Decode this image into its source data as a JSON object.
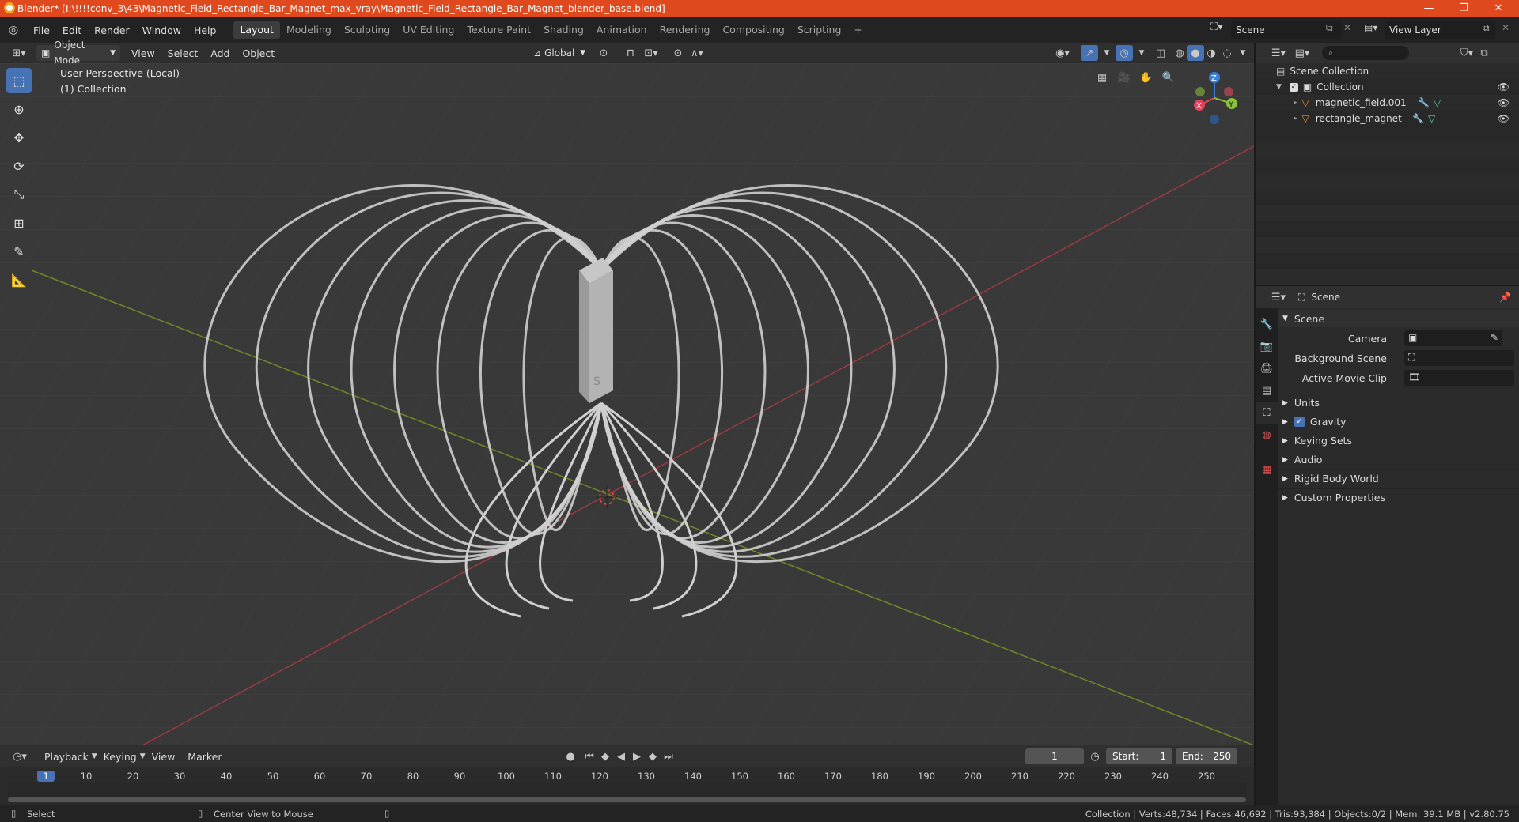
{
  "window": {
    "title": "Blender* [I:\\!!!!conv_3\\43\\Magnetic_Field_Rectangle_Bar_Magnet_max_vray\\Magnetic_Field_Rectangle_Bar_Magnet_blender_base.blend]",
    "minimize": "—",
    "maximize": "❐",
    "close": "✕"
  },
  "menu": {
    "items": [
      "File",
      "Edit",
      "Render",
      "Window",
      "Help"
    ],
    "workspaces": [
      "Layout",
      "Modeling",
      "Sculpting",
      "UV Editing",
      "Texture Paint",
      "Shading",
      "Animation",
      "Rendering",
      "Compositing",
      "Scripting"
    ],
    "active_workspace": "Layout",
    "add_workspace": "+",
    "scene_label": "Scene",
    "view_layer_label": "View Layer"
  },
  "viewport_header": {
    "mode": "Object Mode",
    "menus": [
      "View",
      "Select",
      "Add",
      "Object"
    ],
    "orientation": "Global"
  },
  "viewport": {
    "perspective": "User Perspective (Local)",
    "collection": "(1) Collection",
    "gizmo": {
      "x": "X",
      "y": "Y",
      "z": "Z"
    },
    "colors": {
      "background": "#393939",
      "grid": "#434343",
      "x_axis": "#9a3a44",
      "y_axis": "#6f8a26",
      "field_lines": "#cfcfcf"
    }
  },
  "outliner": {
    "root": "Scene Collection",
    "collection": "Collection",
    "objects": [
      "magnetic_field.001",
      "rectangle_magnet"
    ]
  },
  "properties": {
    "context": "Scene",
    "panel_title": "Scene",
    "fields": {
      "camera": "Camera",
      "background_scene": "Background Scene",
      "active_movie_clip": "Active Movie Clip"
    },
    "sections": [
      "Units",
      "Gravity",
      "Keying Sets",
      "Audio",
      "Rigid Body World",
      "Custom Properties"
    ],
    "gravity_checked": true
  },
  "timeline": {
    "menus": [
      "Playback",
      "Keying",
      "View",
      "Marker"
    ],
    "current_frame": "1",
    "start_label": "Start:",
    "start": "1",
    "end_label": "End:",
    "end": "250",
    "ruler": [
      "1",
      "10",
      "20",
      "30",
      "40",
      "50",
      "60",
      "70",
      "80",
      "90",
      "100",
      "110",
      "120",
      "130",
      "140",
      "150",
      "160",
      "170",
      "180",
      "190",
      "200",
      "210",
      "220",
      "230",
      "240",
      "250"
    ]
  },
  "status": {
    "left_action": "Select",
    "mid_action": "Center View to Mouse",
    "stats": "Collection | Verts:48,734 | Faces:46,692 | Tris:93,384 | Objects:0/2 | Mem: 39.1 MB | v2.80.75"
  }
}
